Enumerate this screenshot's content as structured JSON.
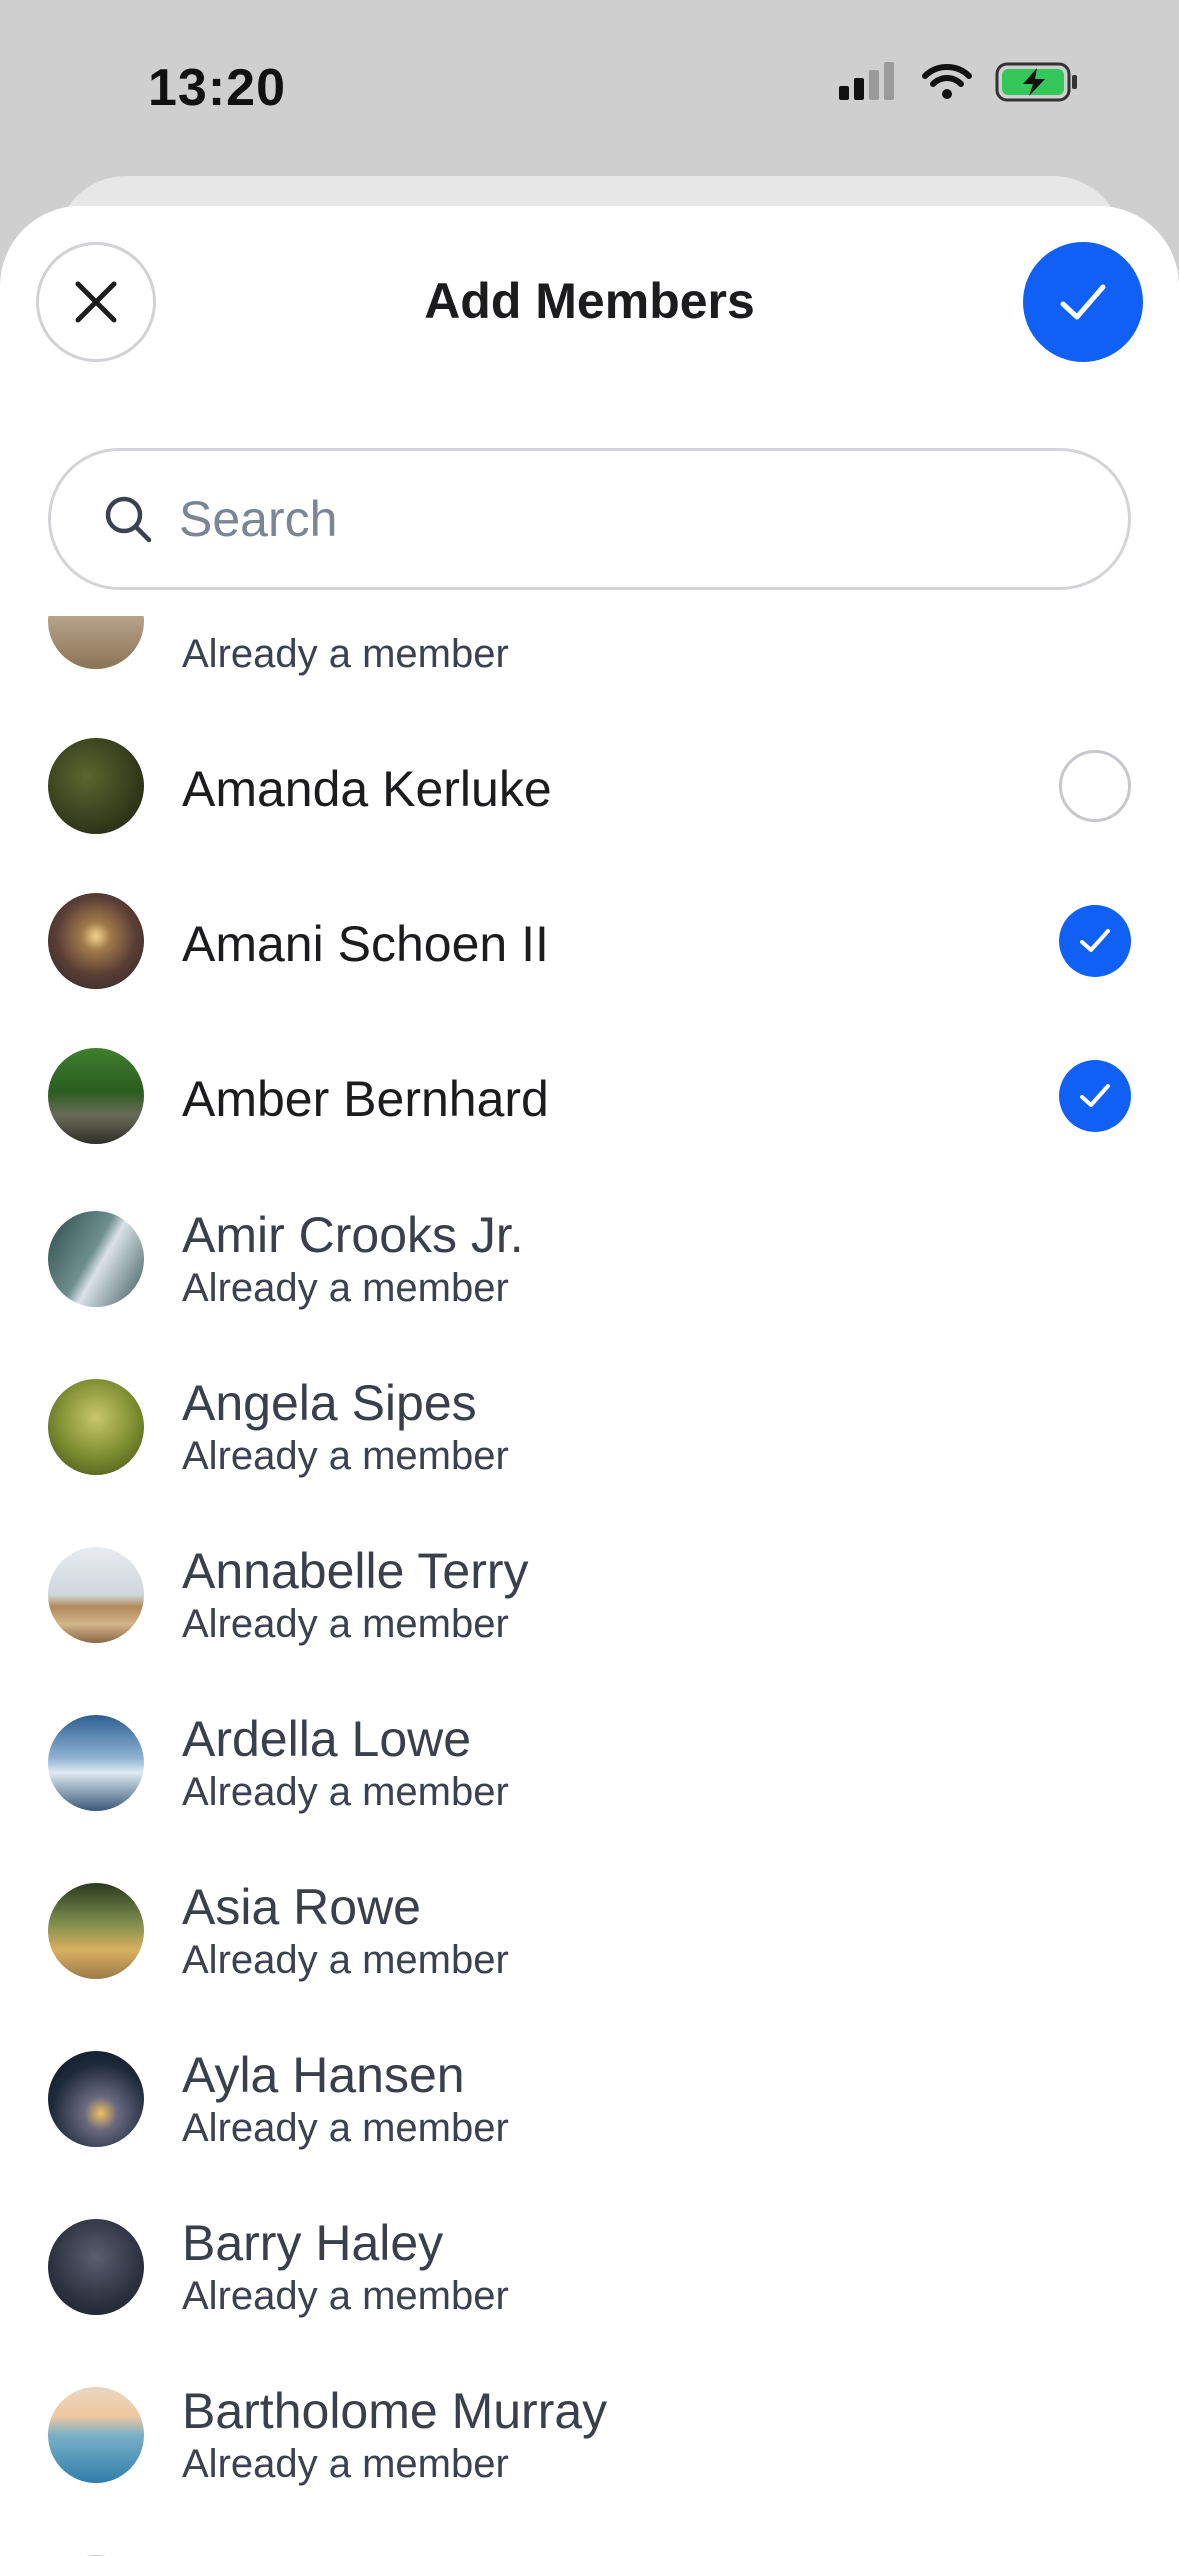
{
  "status": {
    "time": "13:20"
  },
  "header": {
    "title": "Add Members"
  },
  "search": {
    "placeholder": "Search",
    "value": ""
  },
  "colors": {
    "accent": "#1160f5"
  },
  "rows": [
    {
      "name": "",
      "subtitle": "Already a member",
      "state": "member"
    },
    {
      "name": "Amanda Kerluke",
      "subtitle": "",
      "state": "unselected"
    },
    {
      "name": "Amani Schoen II",
      "subtitle": "",
      "state": "selected"
    },
    {
      "name": "Amber Bernhard",
      "subtitle": "",
      "state": "selected"
    },
    {
      "name": "Amir Crooks Jr.",
      "subtitle": "Already a member",
      "state": "member"
    },
    {
      "name": "Angela Sipes",
      "subtitle": "Already a member",
      "state": "member"
    },
    {
      "name": "Annabelle Terry",
      "subtitle": "Already a member",
      "state": "member"
    },
    {
      "name": "Ardella Lowe",
      "subtitle": "Already a member",
      "state": "member"
    },
    {
      "name": "Asia Rowe",
      "subtitle": "Already a member",
      "state": "member"
    },
    {
      "name": "Ayla Hansen",
      "subtitle": "Already a member",
      "state": "member"
    },
    {
      "name": "Barry Haley",
      "subtitle": "Already a member",
      "state": "member"
    },
    {
      "name": "Bartholome Murray",
      "subtitle": "Already a member",
      "state": "member"
    }
  ]
}
